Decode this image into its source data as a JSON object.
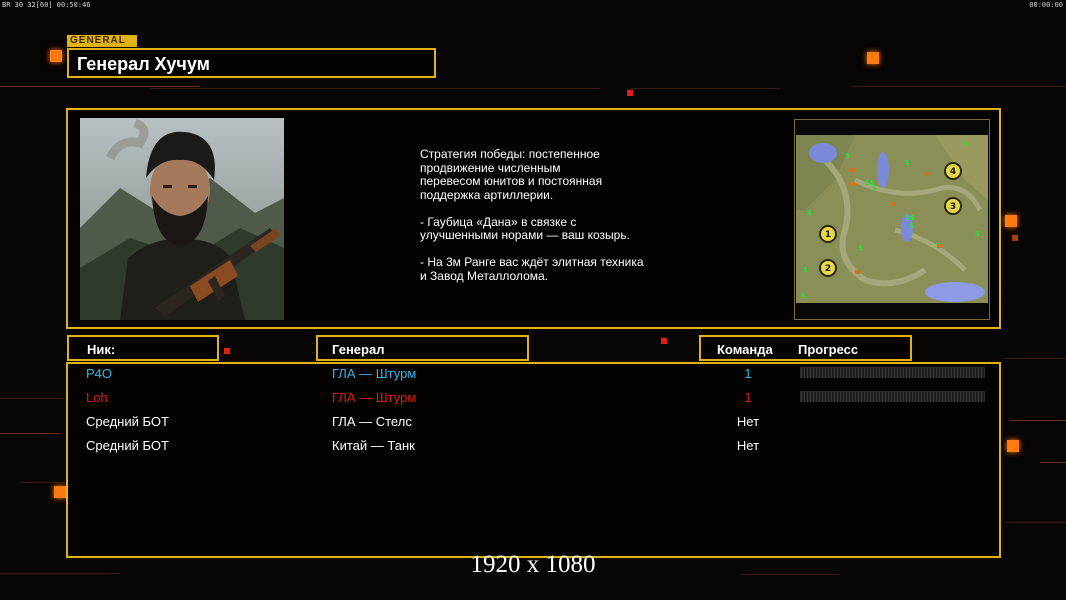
{
  "hud": {
    "left_text": "ВR 30 32[60] 00:50:46",
    "right_text": "00:00:00"
  },
  "colors": {
    "accent": "#e0b410",
    "team_cyan": "#35b6e6",
    "team_red": "#e01818",
    "text_white": "#ffffff",
    "glow_orange": "#ff7a10"
  },
  "header": {
    "tag": "GENERAL",
    "title": "Генерал Хучум"
  },
  "general_info": {
    "portrait": "bearded-general-with-rifle",
    "description": "Стратегия победы: постепенное\nпродвижение численным\nперевесом юнитов и постоянная\nподдержка артиллерии.\n\n- Гаубица «Дана» в связке с\nулучшенными норами — ваш козырь.\n\n- На 3м Ранге вас ждёт элитная техника\nи Завод Металлолома."
  },
  "minimap": {
    "start_positions": [
      "1",
      "2",
      "3",
      "4"
    ],
    "resource_icon": "$"
  },
  "table": {
    "headers": {
      "nick": "Ник:",
      "general": "Генерал",
      "team": "Команда",
      "progress": "Прогресс"
    },
    "rows": [
      {
        "nick": "P4O",
        "general": "ГЛА — Штурм",
        "team": "1",
        "color": "#35b6e6",
        "has_progress": true
      },
      {
        "nick": "Loh",
        "general": "ГЛА — Штурм",
        "team": "1",
        "color": "#e01818",
        "has_progress": true
      },
      {
        "nick": "Средний БОТ",
        "general": "ГЛА — Стелс",
        "team": "Нет",
        "color": "#ffffff",
        "has_progress": false
      },
      {
        "nick": "Средний БОТ",
        "general": "Китай — Танк",
        "team": "Нет",
        "color": "#ffffff",
        "has_progress": false
      }
    ]
  },
  "footer": {
    "resolution": "1920 x 1080"
  }
}
